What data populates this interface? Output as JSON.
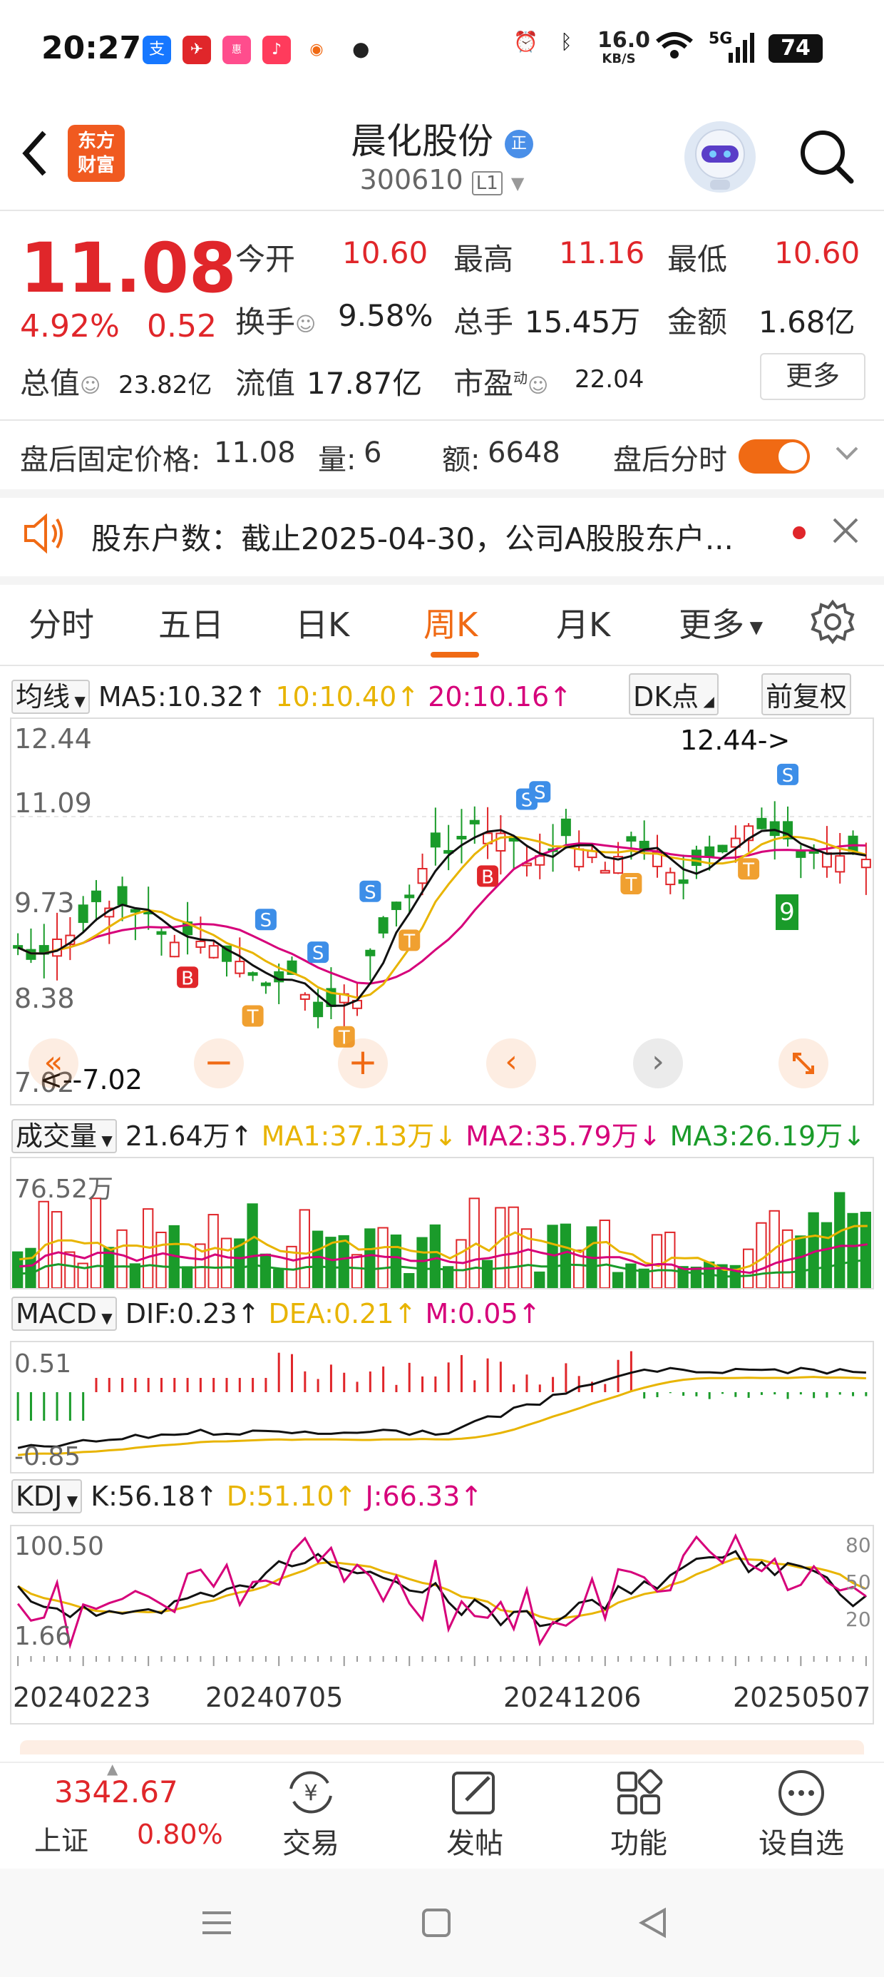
{
  "status_bar": {
    "time": "20:27",
    "net_speed": "16.0",
    "net_unit": "KB/S",
    "network": "5G",
    "battery": "74"
  },
  "header": {
    "logo_line1": "东方",
    "logo_line2": "财富",
    "stock_name": "晨化股份",
    "name_badge": "正",
    "stock_code": "300610",
    "level": "L1"
  },
  "quote": {
    "price": "11.08",
    "change_pct": "4.92%",
    "change_amt": "0.52",
    "open_label": "今开",
    "open": "10.60",
    "high_label": "最高",
    "high": "11.16",
    "low_label": "最低",
    "low": "10.60",
    "turnover_label": "换手",
    "turnover": "9.58%",
    "volume_label": "总手",
    "volume": "15.45万",
    "amount_label": "金额",
    "amount": "1.68亿",
    "mktcap_label": "总值",
    "mktcap": "23.82亿",
    "float_label": "流值",
    "float_cap": "17.87亿",
    "pe_label": "市盈",
    "pe_sup": "动",
    "pe": "22.04",
    "more_label": "更多"
  },
  "after_hours": {
    "price_label": "盘后固定价格:",
    "price": "11.08",
    "vol_label": "量:",
    "vol": "6",
    "amt_label": "额:",
    "amt": "6648",
    "timeshare_label": "盘后分时"
  },
  "notice": "股东户数：截止2025-04-30，公司A股股东户...",
  "tabs": [
    "分时",
    "五日",
    "日K",
    "周K",
    "月K",
    "更多"
  ],
  "active_tab": "周K",
  "kline": {
    "ma_selector": "均线",
    "ma5": "MA5:10.32",
    "ma10": "10:10.40",
    "ma20": "20:10.16",
    "dk_label": "DK点",
    "adjust_label": "前复权",
    "y_top": "12.44",
    "y_mid": "11.09",
    "y_mid2": "9.73",
    "y_low": "8.38",
    "y_bottom": "7.02",
    "high_marker": "12.44->",
    "low_marker": "<--7.02",
    "tdx_nine": "9"
  },
  "volume": {
    "selector": "成交量",
    "value": "21.64万",
    "ma1": "MA1:37.13万",
    "ma2": "MA2:35.79万",
    "ma3": "MA3:26.19万",
    "y_top": "76.52万"
  },
  "macd": {
    "selector": "MACD",
    "dif": "DIF:0.23",
    "dea": "DEA:0.21",
    "m": "M:0.05",
    "y_top": "0.51",
    "y_bottom": "-0.85"
  },
  "kdj": {
    "selector": "KDJ",
    "k": "K:56.18",
    "d": "D:51.10",
    "j": "J:66.33",
    "y_top": "100.50",
    "y_bottom": "1.66",
    "r80": "80",
    "r50": "50",
    "r20": "20",
    "dates": [
      "20240223",
      "20240705",
      "20241206",
      "20250507"
    ]
  },
  "bottom_nav": {
    "index_value": "3342.67",
    "index_name": "上证",
    "index_change": "0.80%",
    "trade": "交易",
    "post": "发帖",
    "function": "功能",
    "watchlist": "设自选"
  },
  "colors": {
    "up": "#e0262a",
    "down": "#1a9b2a",
    "accent": "#f06a14",
    "ma5": "#111111",
    "ma10": "#e8b400",
    "ma20": "#d6007a"
  }
}
